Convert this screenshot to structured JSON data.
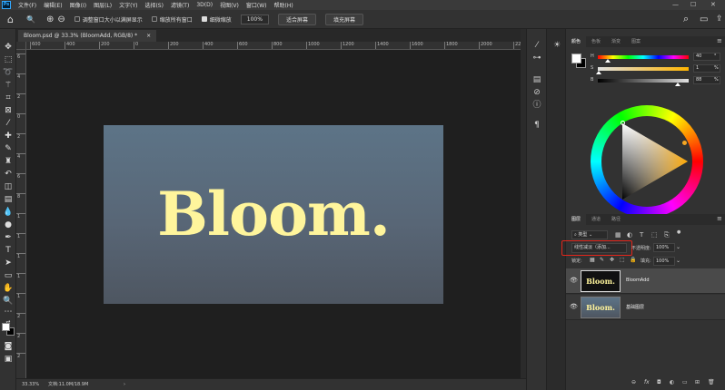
{
  "menubar": {
    "logo": "Ps",
    "items": [
      "文件(F)",
      "编辑(E)",
      "图像(I)",
      "图层(L)",
      "文字(Y)",
      "选择(S)",
      "滤镜(T)",
      "3D(D)",
      "视图(V)",
      "窗口(W)",
      "帮助(H)"
    ],
    "minimize": "—",
    "maximize": "☐",
    "close": "✕"
  },
  "options": {
    "home_icon": "⌂",
    "zoom_icon": "🔍",
    "zoom_in_icon": "⊕",
    "zoom_out_icon": "⊖",
    "resize_windows_label": "调整窗口大小以满屏显示",
    "zoom_all_windows_label": "缩放所有窗口",
    "scrubby_zoom_label": "细微缩放",
    "zoom_value": "100%",
    "fit_screen_label": "适合屏幕",
    "fill_screen_label": "填充屏幕",
    "search_icon": "⌕",
    "workspace_icon": "▭"
  },
  "document": {
    "tab_title": "Bloom.psd @ 33.3% (BloomAdd, RGB/8) *",
    "tab_close": "×",
    "canvas_text": "Bloom."
  },
  "ruler": {
    "h_labels": [
      "600",
      "400",
      "200",
      "0",
      "200",
      "400",
      "600",
      "800",
      "1000",
      "1200",
      "1400",
      "1600",
      "1800",
      "2000",
      "2200",
      "2400",
      "2600"
    ],
    "v_labels": [
      "6",
      "4",
      "2",
      "0",
      "2",
      "4",
      "6",
      "8",
      "1",
      "1",
      "1",
      "1",
      "1",
      "2",
      "2",
      "2"
    ]
  },
  "statusbar": {
    "zoom": "33.33%",
    "doc_info": "文档:11.0M/18.9M",
    "arrow": "›"
  },
  "color_panel": {
    "tabs": [
      "颜色",
      "色板",
      "渐变",
      "图案"
    ],
    "h_label": "H",
    "s_label": "S",
    "b_label": "B",
    "h_value": "40",
    "s_value": "1",
    "b_value": "88",
    "unit_deg": "°",
    "unit_pct": "%",
    "hue_fraction": 0.11,
    "sat_fraction": 0.01,
    "bright_fraction": 0.88,
    "foreground_color": "#ffffff",
    "background_color": "#000000"
  },
  "layers_panel": {
    "tabs": [
      "图层",
      "通道",
      "路径"
    ],
    "filter_label": "类型",
    "filter_icons": [
      "▦",
      "◐",
      "T",
      "⬚",
      "⎘",
      "●"
    ],
    "blend_mode": "线性减淡（添加...",
    "opacity_label": "不透明度:",
    "opacity_value": "100%",
    "lock_label": "锁定:",
    "fill_label": "填充:",
    "fill_value": "100%",
    "layers": [
      {
        "name": "BloomAdd",
        "thumb_text": "Bloom.",
        "selected": true
      },
      {
        "name": "基础图层",
        "thumb_text": "Bloom.",
        "selected": false
      }
    ],
    "bottom_icons": [
      "⊖",
      "fx",
      "◘",
      "◐",
      "▭",
      "⊞",
      "🗑"
    ]
  },
  "colors": {
    "accent_blue": "#31a8ff",
    "highlight_red": "#e3261b",
    "text_yellow": "#fff59c"
  }
}
